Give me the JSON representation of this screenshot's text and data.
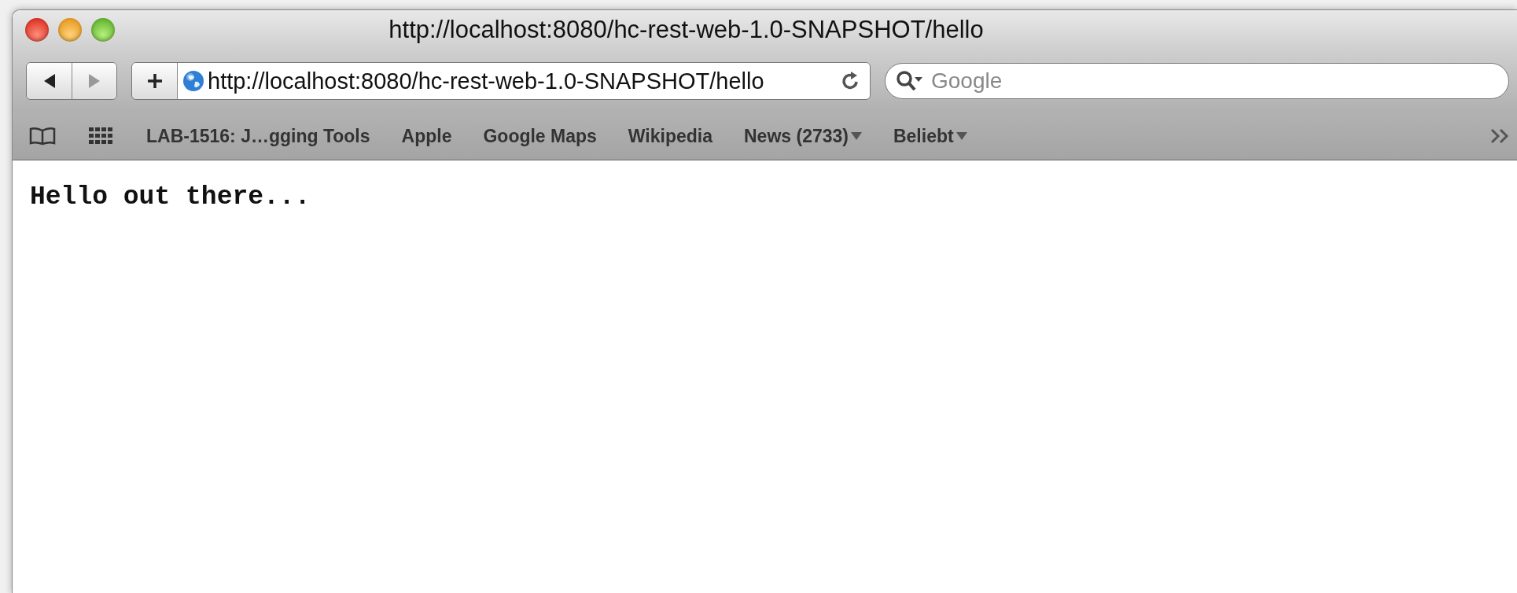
{
  "window": {
    "title": "http://localhost:8080/hc-rest-web-1.0-SNAPSHOT/hello"
  },
  "toolbar": {
    "back_disabled": false,
    "forward_disabled": true,
    "address": "http://localhost:8080/hc-rest-web-1.0-SNAPSHOT/hello",
    "search": {
      "placeholder": "Google"
    }
  },
  "bookmarks": [
    {
      "label": "LAB-1516: J…gging Tools",
      "kind": "link"
    },
    {
      "label": "Apple",
      "kind": "link"
    },
    {
      "label": "Google Maps",
      "kind": "link"
    },
    {
      "label": "Wikipedia",
      "kind": "link"
    },
    {
      "label": "News (2733)",
      "kind": "menu"
    },
    {
      "label": "Beliebt",
      "kind": "menu"
    }
  ],
  "page": {
    "text": "Hello out there..."
  }
}
